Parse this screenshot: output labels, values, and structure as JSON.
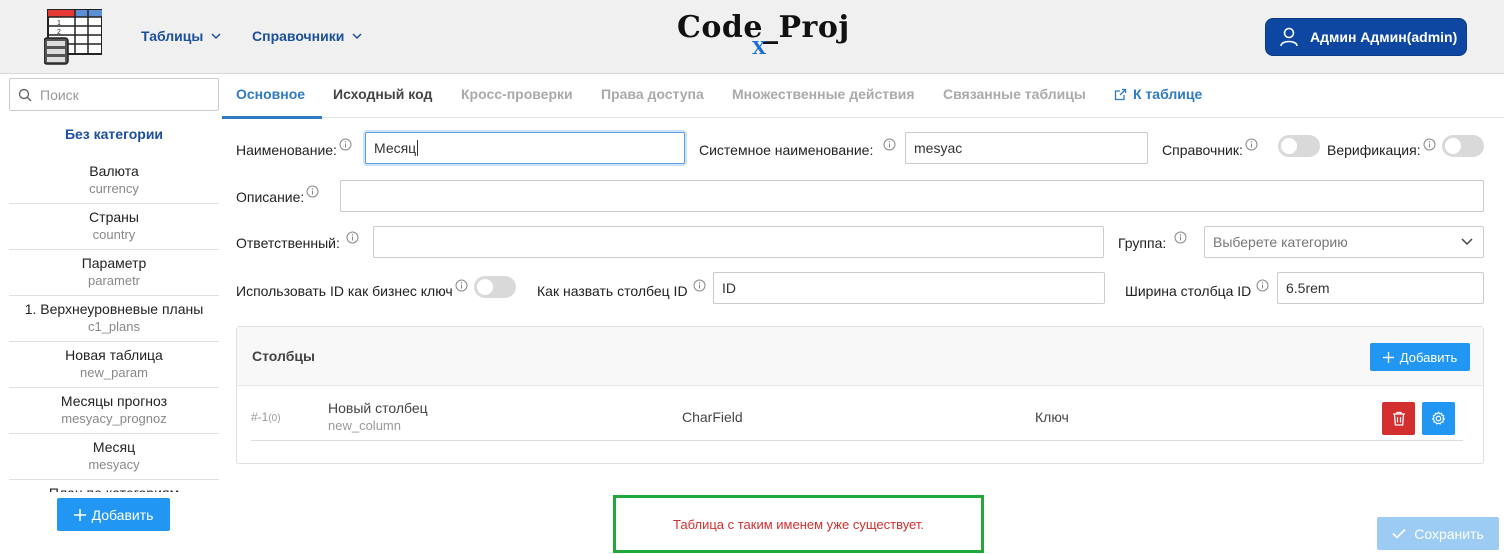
{
  "header": {
    "nav": [
      {
        "label": "Таблицы"
      },
      {
        "label": "Справочники"
      }
    ],
    "brand": "Code_Proj",
    "brand_sub": "X",
    "user": "Админ Админ(admin)"
  },
  "sidebar": {
    "search_placeholder": "Поиск",
    "category": "Без категории",
    "items": [
      {
        "title": "Валюта",
        "sys": "currency"
      },
      {
        "title": "Страны",
        "sys": "country"
      },
      {
        "title": "Параметр",
        "sys": "parametr"
      },
      {
        "title": "1. Верхнеуровневые планы",
        "sys": "c1_plans"
      },
      {
        "title": "Новая таблица",
        "sys": "new_param"
      },
      {
        "title": "Месяцы прогноз",
        "sys": "mesyacy_prognoz"
      },
      {
        "title": "Месяц",
        "sys": "mesyacy"
      },
      {
        "title": "План по категориям",
        "sys": ""
      }
    ],
    "add_label": "Добавить"
  },
  "tabs": [
    {
      "label": "Основное"
    },
    {
      "label": "Исходный код"
    },
    {
      "label": "Кросс-проверки"
    },
    {
      "label": "Права доступа"
    },
    {
      "label": "Множественные действия"
    },
    {
      "label": "Связанные таблицы"
    },
    {
      "label": "К таблице"
    }
  ],
  "form": {
    "name_label": "Наименование:",
    "name_value": "Месяц",
    "sysname_label": "Системное наименование:",
    "sysname_value": "mesyac",
    "dict_label": "Справочник:",
    "verify_label": "Верификация:",
    "desc_label": "Описание:",
    "desc_value": "",
    "resp_label": "Ответственный:",
    "resp_value": "",
    "group_label": "Группа:",
    "group_placeholder": "Выберете категорию",
    "use_id_label": "Использовать ID как бизнес ключ",
    "id_name_label": "Как назвать столбец ID",
    "id_name_value": "ID",
    "id_width_label": "Ширина столбца ID",
    "id_width_value": "6.5rem"
  },
  "columns": {
    "title": "Столбцы",
    "add_label": "Добавить",
    "rows": [
      {
        "idx": "#-1",
        "order": "(0)",
        "name": "Новый столбец",
        "sys": "new_column",
        "type": "CharField",
        "key": "Ключ"
      }
    ]
  },
  "alert": "Таблица с таким именем уже существует.",
  "save_label": "Сохранить",
  "colors": {
    "primary": "#2196f3",
    "nav": "#1c4f9c",
    "user_btn": "#0d47a1",
    "danger": "#d32f2f",
    "alert_border": "#22a83a"
  }
}
